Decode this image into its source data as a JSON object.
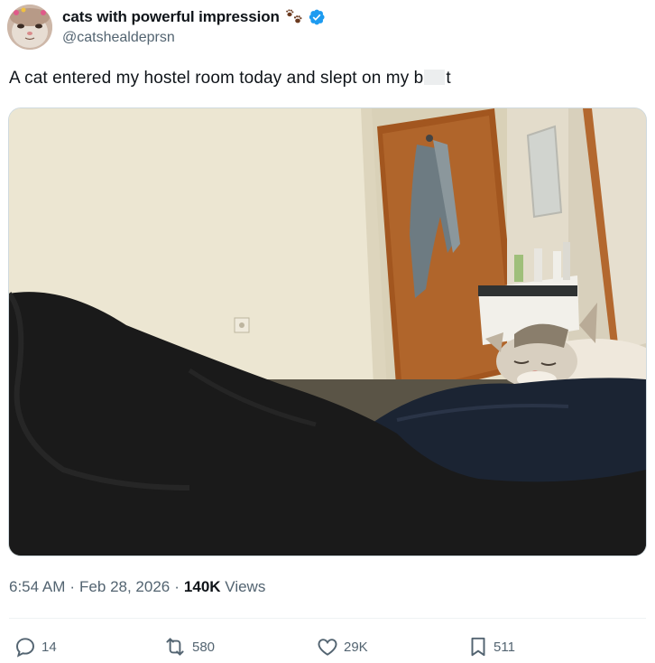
{
  "author": {
    "display_name": "cats with powerful impression",
    "handle": "@catshealdeprsn",
    "emoji_icon": "paw-prints-icon",
    "badge_icon": "verified-badge-icon",
    "badge_color": "#1d9bf0"
  },
  "tweet": {
    "text_before": "A cat entered my hostel room today and slept on my b",
    "text_after": "t"
  },
  "meta": {
    "time": "6:54 AM",
    "separator": "·",
    "date": "Feb 28, 2026",
    "views_count": "140K",
    "views_label": "Views"
  },
  "actions": {
    "replies": "14",
    "reposts": "580",
    "likes": "29K",
    "bookmarks": "511"
  },
  "colors": {
    "text_primary": "#0f1419",
    "text_secondary": "#536471"
  }
}
